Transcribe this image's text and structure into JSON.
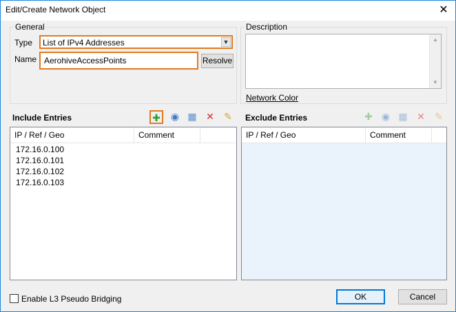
{
  "window": {
    "title": "Edit/Create Network Object",
    "close_glyph": "✕"
  },
  "general": {
    "legend": "General",
    "type_label": "Type",
    "type_value": "List of IPv4 Addresses",
    "name_label": "Name",
    "name_value": "AerohiveAccessPoints",
    "resolve_label": "Resolve"
  },
  "description": {
    "legend": "Description",
    "value": "",
    "network_color_link": "Network Color"
  },
  "include": {
    "title": "Include Entries",
    "columns": [
      "IP / Ref / Geo",
      "Comment"
    ],
    "rows": [
      "172.16.0.100",
      "172.16.0.101",
      "172.16.0.102",
      "172.16.0.103"
    ]
  },
  "exclude": {
    "title": "Exclude Entries",
    "columns": [
      "IP / Ref / Geo",
      "Comment"
    ],
    "rows": []
  },
  "footer": {
    "bridging_label": "Enable L3 Pseudo Bridging",
    "bridging_checked": false,
    "ok_label": "OK",
    "cancel_label": "Cancel"
  },
  "icons": [
    "add-icon",
    "globe-icon",
    "add-group-icon",
    "delete-icon",
    "edit-icon"
  ],
  "colors": {
    "highlight": "#e07a1f",
    "disabled_list_bg": "#eaf2fb",
    "ok_border": "#0078d7"
  }
}
